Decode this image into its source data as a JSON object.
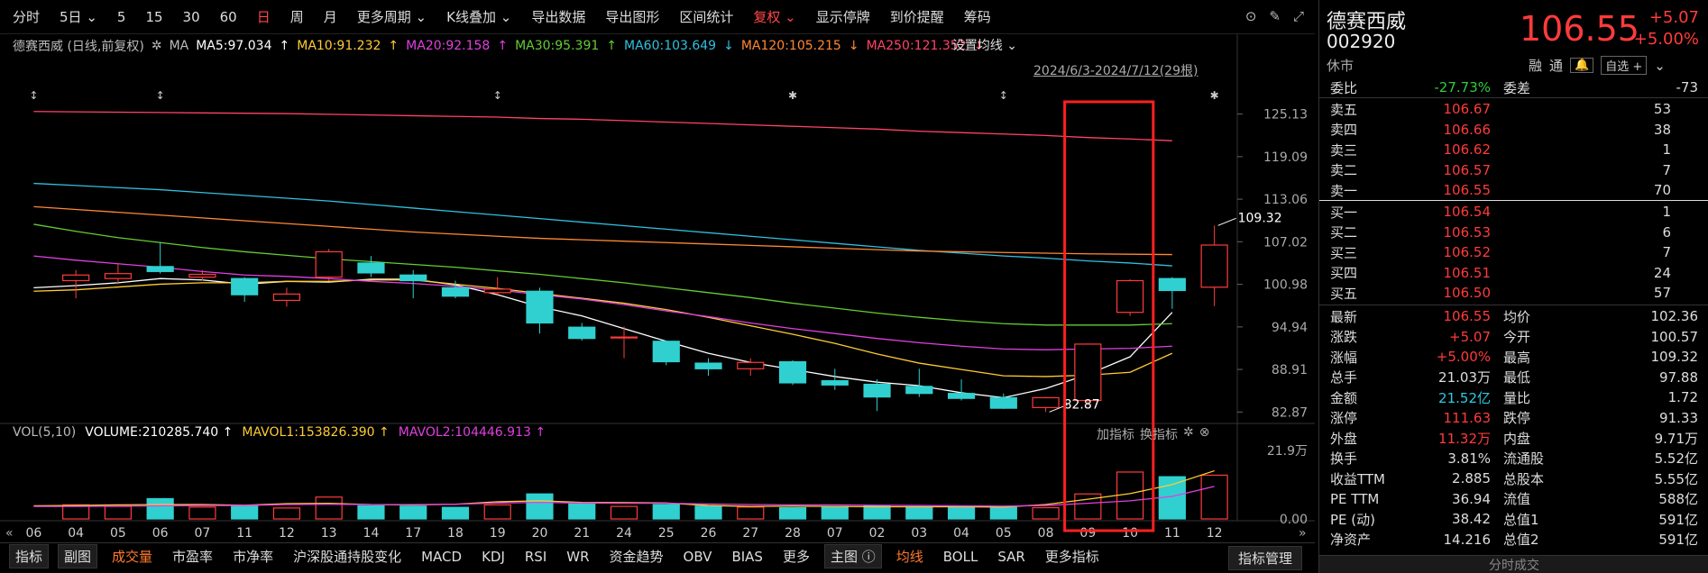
{
  "toolbar": {
    "items": [
      "分时",
      "5日",
      "5",
      "15",
      "30",
      "60",
      "日",
      "周",
      "月",
      "更多周期",
      "K线叠加",
      "导出数据",
      "导出图形",
      "区间统计",
      "复权",
      "显示停牌",
      "到价提醒",
      "筹码"
    ],
    "active_index": 6,
    "restore_index": 14
  },
  "ma_legend": {
    "title": "德赛西威 (日线,前复权)",
    "ma_label": "MA",
    "items": [
      {
        "text": "MA5:97.034",
        "arrow": "↑",
        "color": "#ffffff"
      },
      {
        "text": "MA10:91.232",
        "arrow": "↑",
        "color": "#ffcc33"
      },
      {
        "text": "MA20:92.158",
        "arrow": "↑",
        "color": "#e040e0"
      },
      {
        "text": "MA30:95.391",
        "arrow": "↑",
        "color": "#66cc33"
      },
      {
        "text": "MA60:103.649",
        "arrow": "↓",
        "color": "#30c0e0"
      },
      {
        "text": "MA120:105.215",
        "arrow": "↓",
        "color": "#ff8833"
      },
      {
        "text": "MA250:121.352",
        "arrow": "↓",
        "color": "#ff4466"
      }
    ],
    "setting": "设置均线"
  },
  "date_range": "2024/6/3-2024/7/12(29根)",
  "y_axis_labels": [
    "125.13",
    "119.09",
    "113.06",
    "107.02",
    "100.98",
    "94.94",
    "88.91",
    "82.87"
  ],
  "high_label": "109.32",
  "low_label": "82.87",
  "x_axis_labels": [
    "06",
    "04",
    "05",
    "06",
    "07",
    "11",
    "12",
    "13",
    "14",
    "17",
    "18",
    "19",
    "20",
    "21",
    "24",
    "25",
    "26",
    "27",
    "28",
    "07",
    "02",
    "03",
    "04",
    "05",
    "08",
    "09",
    "10",
    "11",
    "12"
  ],
  "volume": {
    "header": "VOL(5,10)",
    "items": [
      {
        "text": "VOLUME:210285.740",
        "arrow": "↑",
        "color": "#ffffff"
      },
      {
        "text": "MAVOL1:153826.390",
        "arrow": "↑",
        "color": "#ffcc33"
      },
      {
        "text": "MAVOL2:104446.913",
        "arrow": "↑",
        "color": "#e040e0"
      }
    ],
    "tools": [
      "加指标",
      "换指标"
    ],
    "y_labels": [
      "21.9万",
      "0.00"
    ]
  },
  "chart_data": {
    "type": "candlestick",
    "candles": [
      {
        "o": 101.5,
        "c": 102.3,
        "h": 103.0,
        "l": 99.0
      },
      {
        "o": 101.8,
        "c": 102.5,
        "h": 104.0,
        "l": 101.0
      },
      {
        "o": 103.5,
        "c": 102.8,
        "h": 107.0,
        "l": 102.5
      },
      {
        "o": 102.0,
        "c": 102.4,
        "h": 103.0,
        "l": 101.5
      },
      {
        "o": 101.8,
        "c": 99.5,
        "h": 102.0,
        "l": 98.5
      },
      {
        "o": 98.7,
        "c": 99.6,
        "h": 100.5,
        "l": 97.8
      },
      {
        "o": 102.0,
        "c": 105.6,
        "h": 106.0,
        "l": 101.5
      },
      {
        "o": 104.0,
        "c": 102.6,
        "h": 105.0,
        "l": 102.0
      },
      {
        "o": 102.3,
        "c": 101.5,
        "h": 103.0,
        "l": 99.0
      },
      {
        "o": 100.5,
        "c": 99.3,
        "h": 101.5,
        "l": 99.0
      },
      {
        "o": 99.8,
        "c": 100.3,
        "h": 102.0,
        "l": 99.5
      },
      {
        "o": 100.0,
        "c": 95.5,
        "h": 100.5,
        "l": 94.0
      },
      {
        "o": 94.9,
        "c": 93.3,
        "h": 95.5,
        "l": 93.0
      },
      {
        "o": 93.5,
        "c": 93.5,
        "h": 95.0,
        "l": 90.5
      },
      {
        "o": 92.9,
        "c": 90.0,
        "h": 93.0,
        "l": 89.5
      },
      {
        "o": 89.8,
        "c": 89.0,
        "h": 90.5,
        "l": 88.0
      },
      {
        "o": 89.0,
        "c": 89.9,
        "h": 90.5,
        "l": 88.0
      },
      {
        "o": 90.0,
        "c": 87.0,
        "h": 90.2,
        "l": 86.7
      },
      {
        "o": 87.3,
        "c": 86.7,
        "h": 89.0,
        "l": 86.0
      },
      {
        "o": 86.8,
        "c": 85.0,
        "h": 87.5,
        "l": 83.0
      },
      {
        "o": 86.5,
        "c": 85.5,
        "h": 89.0,
        "l": 85.0
      },
      {
        "o": 85.5,
        "c": 84.8,
        "h": 87.5,
        "l": 84.5
      },
      {
        "o": 84.9,
        "c": 83.4,
        "h": 85.5,
        "l": 83.3
      },
      {
        "o": 83.5,
        "c": 84.9,
        "h": 85.0,
        "l": 82.87
      },
      {
        "o": 84.5,
        "c": 92.5,
        "h": 92.6,
        "l": 83.8
      },
      {
        "o": 97.0,
        "c": 101.5,
        "h": 101.7,
        "l": 96.5
      },
      {
        "o": 101.8,
        "c": 100.1,
        "h": 102.0,
        "l": 97.5
      },
      {
        "o": 100.57,
        "c": 106.55,
        "h": 109.32,
        "l": 97.88
      }
    ],
    "ma_lines": [
      {
        "name": "MA5",
        "color": "#ffffff",
        "values": [
          100.5,
          100.8,
          101.2,
          101.8,
          101.6,
          101.0,
          101.4,
          101.3,
          101.7,
          101.7,
          100.9,
          99.5,
          97.8,
          96.5,
          94.7,
          92.9,
          91.2,
          89.9,
          88.9,
          87.9,
          87.1,
          86.6,
          85.6,
          84.9,
          86.2,
          88.2,
          90.7,
          97.0
        ]
      },
      {
        "name": "MA10",
        "color": "#ffcc33",
        "values": [
          100.0,
          100.2,
          100.6,
          101.0,
          101.2,
          101.2,
          101.4,
          101.4,
          101.6,
          101.6,
          101.0,
          100.4,
          99.7,
          99.0,
          98.3,
          97.4,
          96.3,
          95.1,
          93.9,
          92.6,
          91.1,
          89.8,
          88.9,
          88.0,
          87.9,
          88.1,
          88.5,
          91.2
        ]
      },
      {
        "name": "MA20",
        "color": "#e040e0",
        "values": [
          105.0,
          104.4,
          103.9,
          103.4,
          102.8,
          102.3,
          102.1,
          101.8,
          101.4,
          101.1,
          100.7,
          100.2,
          99.5,
          98.9,
          98.1,
          97.2,
          96.4,
          95.5,
          94.7,
          94.0,
          93.3,
          92.7,
          92.2,
          91.8,
          91.7,
          91.8,
          91.9,
          92.2
        ]
      },
      {
        "name": "MA30",
        "color": "#66cc33",
        "values": [
          109.5,
          108.5,
          107.6,
          106.9,
          106.2,
          105.6,
          105.1,
          104.6,
          104.2,
          103.8,
          103.4,
          102.9,
          102.4,
          101.8,
          101.2,
          100.5,
          99.8,
          99.1,
          98.3,
          97.6,
          96.9,
          96.3,
          95.8,
          95.4,
          95.2,
          95.2,
          95.2,
          95.4
        ]
      },
      {
        "name": "MA60",
        "color": "#30c0e0",
        "values": [
          115.3,
          115.0,
          114.7,
          114.4,
          114.0,
          113.6,
          113.2,
          112.8,
          112.3,
          111.8,
          111.3,
          110.8,
          110.3,
          109.8,
          109.3,
          108.8,
          108.3,
          107.8,
          107.3,
          106.8,
          106.3,
          105.8,
          105.4,
          105.0,
          104.7,
          104.3,
          104.0,
          103.6
        ]
      },
      {
        "name": "MA120",
        "color": "#ff8833",
        "values": [
          112.0,
          111.6,
          111.2,
          110.8,
          110.4,
          110.0,
          109.6,
          109.2,
          108.8,
          108.4,
          108.1,
          107.8,
          107.5,
          107.3,
          107.1,
          106.9,
          106.7,
          106.5,
          106.3,
          106.1,
          105.9,
          105.7,
          105.6,
          105.5,
          105.4,
          105.3,
          105.25,
          105.2
        ]
      },
      {
        "name": "MA250",
        "color": "#ff4466",
        "values": [
          125.5,
          125.45,
          125.4,
          125.35,
          125.3,
          125.25,
          125.2,
          125.1,
          125.0,
          124.9,
          124.8,
          124.7,
          124.5,
          124.4,
          124.2,
          124.0,
          123.8,
          123.6,
          123.4,
          123.2,
          123.0,
          122.7,
          122.5,
          122.3,
          122.1,
          121.8,
          121.6,
          121.35
        ]
      }
    ],
    "y_range": [
      81.5,
      127.0
    ],
    "volumes": [
      4.5,
      4.0,
      6.5,
      3.8,
      4.2,
      3.5,
      7.0,
      4.2,
      4.1,
      3.7,
      4.5,
      8.0,
      4.8,
      4.0,
      4.6,
      4.1,
      3.8,
      3.6,
      4.0,
      4.3,
      3.9,
      3.8,
      3.7,
      3.6,
      8.0,
      15.0,
      13.5,
      14.0
    ],
    "vol_ma1": [
      4.2,
      4.3,
      4.5,
      4.6,
      4.6,
      4.4,
      4.9,
      5.0,
      4.6,
      4.5,
      4.7,
      5.5,
      5.8,
      5.3,
      5.2,
      5.1,
      4.3,
      4.0,
      4.1,
      4.0,
      3.9,
      3.9,
      3.9,
      3.8,
      4.6,
      6.3,
      8.1,
      11.0,
      15.4
    ],
    "vol_ma2": [
      4.0,
      4.0,
      4.1,
      4.2,
      4.3,
      4.3,
      4.6,
      4.7,
      4.6,
      4.6,
      4.7,
      5.1,
      5.3,
      5.1,
      5.0,
      5.0,
      4.8,
      4.6,
      4.5,
      4.5,
      4.4,
      4.3,
      4.2,
      4.1,
      4.3,
      5.0,
      5.8,
      7.2,
      10.4
    ],
    "vol_range": [
      0,
      21.9
    ]
  },
  "bottom_tabs": [
    "指标",
    "副图",
    "成交量",
    "市盈率",
    "市净率",
    "沪深股通持股变化",
    "MACD",
    "KDJ",
    "RSI",
    "WR",
    "资金趋势",
    "OBV",
    "BIAS",
    "更多",
    "主图",
    "均线",
    "BOLL",
    "SAR",
    "更多指标"
  ],
  "bottom_right": "指标管理",
  "quote": {
    "name": "德赛西威",
    "code": "002920",
    "status": "休市",
    "price": "106.55",
    "change": "+5.07",
    "change_pct": "+5.00%",
    "tags": [
      "融",
      "通"
    ],
    "watch_label": "自选 +",
    "order_book_top": [
      {
        "l1": "委比",
        "v1": "-27.73%",
        "c1": "green",
        "l2": "委差",
        "v2": "-73",
        "c2": "green"
      }
    ],
    "asks": [
      {
        "label": "卖五",
        "price": "106.67",
        "vol": "53"
      },
      {
        "label": "卖四",
        "price": "106.66",
        "vol": "38"
      },
      {
        "label": "卖三",
        "price": "106.62",
        "vol": "1"
      },
      {
        "label": "卖二",
        "price": "106.57",
        "vol": "7"
      },
      {
        "label": "卖一",
        "price": "106.55",
        "vol": "70"
      }
    ],
    "bids": [
      {
        "label": "买一",
        "price": "106.54",
        "vol": "1"
      },
      {
        "label": "买二",
        "price": "106.53",
        "vol": "6"
      },
      {
        "label": "买三",
        "price": "106.52",
        "vol": "7"
      },
      {
        "label": "买四",
        "price": "106.51",
        "vol": "24"
      },
      {
        "label": "买五",
        "price": "106.50",
        "vol": "57"
      }
    ],
    "stats": [
      {
        "l1": "最新",
        "v1": "106.55",
        "c1": "red",
        "l2": "均价",
        "v2": "102.36",
        "c2": "red"
      },
      {
        "l1": "涨跌",
        "v1": "+5.07",
        "c1": "red",
        "l2": "今开",
        "v2": "100.57",
        "c2": "green"
      },
      {
        "l1": "涨幅",
        "v1": "+5.00%",
        "c1": "red",
        "l2": "最高",
        "v2": "109.32",
        "c2": "red"
      },
      {
        "l1": "总手",
        "v1": "21.03万",
        "c1": "white",
        "l2": "最低",
        "v2": "97.88",
        "c2": "green"
      },
      {
        "l1": "金额",
        "v1": "21.52亿",
        "c1": "cyan",
        "l2": "量比",
        "v2": "1.72",
        "c2": "white"
      },
      {
        "l1": "涨停",
        "v1": "111.63",
        "c1": "red",
        "l2": "跌停",
        "v2": "91.33",
        "c2": "green"
      },
      {
        "l1": "外盘",
        "v1": "11.32万",
        "c1": "red",
        "l2": "内盘",
        "v2": "9.71万",
        "c2": "green"
      },
      {
        "l1": "换手",
        "v1": "3.81%",
        "c1": "white",
        "l2": "流通股",
        "v2": "5.52亿",
        "c2": "white"
      },
      {
        "l1": "收益TTM",
        "v1": "2.885",
        "c1": "white",
        "l2": "总股本",
        "v2": "5.55亿",
        "c2": "white"
      },
      {
        "l1": "PE TTM",
        "v1": "36.94",
        "c1": "white",
        "l2": "流值",
        "v2": "588亿",
        "c2": "white"
      },
      {
        "l1": "PE (动)",
        "v1": "38.42",
        "c1": "white",
        "l2": "总值1",
        "v2": "591亿",
        "c2": "white"
      },
      {
        "l1": "净资产",
        "v1": "14.216",
        "c1": "white",
        "l2": "总值2",
        "v2": "591亿",
        "c2": "white"
      }
    ],
    "footer": "分时成交"
  }
}
